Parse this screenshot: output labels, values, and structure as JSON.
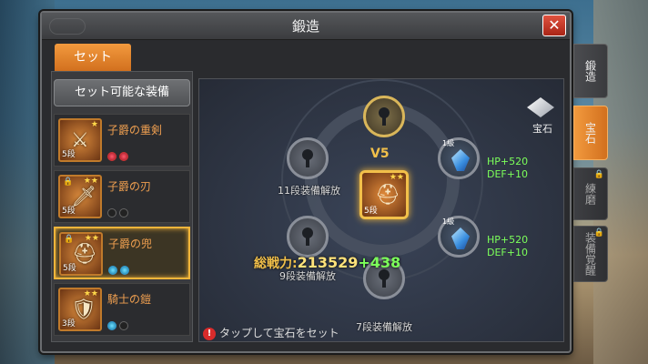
{
  "window": {
    "title": "鍛造",
    "close_label": "✕"
  },
  "tabs": {
    "set": "セット"
  },
  "left_panel": {
    "button_label": "セット可能な装備",
    "items": [
      {
        "name": "子爵の重剣",
        "level": "5段",
        "stars": "★",
        "gems": [
          "red",
          "red"
        ],
        "locked": false,
        "selected": false
      },
      {
        "name": "子爵の刃",
        "level": "5段",
        "stars": "★★",
        "gems": [
          "empty",
          "empty"
        ],
        "locked": true,
        "selected": false
      },
      {
        "name": "子爵の兜",
        "level": "5段",
        "stars": "★★",
        "gems": [
          "blue",
          "blue"
        ],
        "locked": true,
        "selected": true
      },
      {
        "name": "騎士の鎧",
        "level": "3段",
        "stars": "★★",
        "gems": [
          "blue",
          "empty"
        ],
        "locked": false,
        "selected": false
      }
    ]
  },
  "main": {
    "v_label": "V5",
    "center_item_level": "5段",
    "center_item_stars": "★★",
    "slot_texts": {
      "left_top": "11段装備解放",
      "left_bottom": "9段装備解放",
      "bottom": "7段装備解放"
    },
    "gem_slots": [
      {
        "level": "1級",
        "bonus_hp": "HP+520",
        "bonus_def": "DEF+10"
      },
      {
        "level": "1級",
        "bonus_hp": "HP+520",
        "bonus_def": "DEF+10"
      }
    ],
    "power_label": "総戦力:",
    "power_value": "213529",
    "power_delta": "+438",
    "hint_text": "タップして宝石をセット",
    "hint_mark": "!",
    "hoseki_label": "宝石"
  },
  "side_tabs": [
    {
      "label": "鍛造",
      "state": "inactive"
    },
    {
      "label": "宝石",
      "state": "active"
    },
    {
      "label": "練磨",
      "state": "locked"
    },
    {
      "label": "装備覚醒",
      "state": "locked"
    }
  ]
}
